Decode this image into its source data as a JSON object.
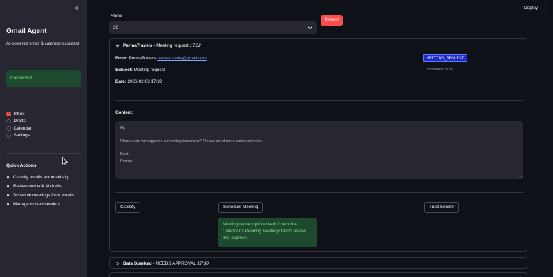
{
  "sidebar": {
    "title": "Gmail Agent",
    "subtitle": "AI-powered email & calendar assistant",
    "status": "Connected",
    "nav": [
      {
        "label": "Inbox",
        "selected": true
      },
      {
        "label": "Drafts",
        "selected": false
      },
      {
        "label": "Calendar",
        "selected": false
      },
      {
        "label": "Settings",
        "selected": false
      }
    ],
    "quick_actions_title": "Quick Actions",
    "quick_actions": [
      "Classify emails automatically",
      "Review and edit AI drafts",
      "Schedule meetings from emails",
      "Manage trusted senders"
    ]
  },
  "header": {
    "deploy_label": "Deploy",
    "menu_icon": "kebab-menu-icon"
  },
  "controls": {
    "show_label": "Show",
    "show_value": "20",
    "refresh_label": "Refresh"
  },
  "emails": [
    {
      "sender": "PermaTravels",
      "subject": "Meeting request",
      "time": "17:32",
      "expanded": true,
      "from_label": "From:",
      "from_name": "PermaTravels",
      "from_email": "permatravels@gmail.com",
      "subject_label": "Subject:",
      "date_label": "Date:",
      "date": "2026-02-03 17:32",
      "classification": "MEETING_REQUEST",
      "confidence": "Confidence: 90%",
      "content_label": "Content:",
      "content": "Hi,\n\nPlease can we organise a meeting tomorrow? Please send me a calendar invite.\n\nBest,\nPerma",
      "actions": {
        "classify": "Classify",
        "schedule": "Schedule Meeting",
        "trust": "Trust Sender"
      },
      "success_message": "Meeting request processed! Check the Calendar > Pending Meetings tab to review and approve."
    },
    {
      "sender": "Data Sparked",
      "subject": "NEEDS APPROVAL",
      "time": "17:30",
      "expanded": false
    }
  ],
  "colors": {
    "background": "#0e1117",
    "sidebar": "#262730",
    "accent": "#ff4b4b",
    "success_bg": "#1d4a2f",
    "success_text": "#7ee08a",
    "tag_bg": "#1f2bc2",
    "link": "#7ea7ff"
  }
}
